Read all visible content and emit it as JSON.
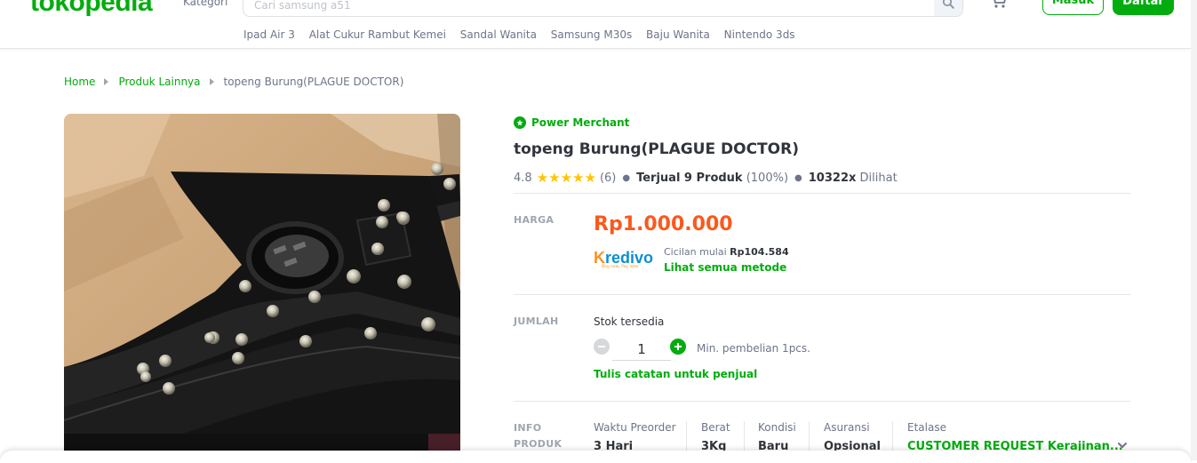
{
  "header": {
    "logo": "tokopedia",
    "kategori": "Kategori",
    "search_placeholder": "Cari samsung a51",
    "login_label": "Masuk",
    "register_label": "Daftar",
    "quick_links": [
      "Ipad Air 3",
      "Alat Cukur Rambut Kemei",
      "Sandal Wanita",
      "Samsung M30s",
      "Baju Wanita",
      "Nintendo 3ds"
    ]
  },
  "breadcrumb": {
    "items": [
      "Home",
      "Produk Lainnya"
    ],
    "current": "topeng Burung(PLAGUE DOCTOR)"
  },
  "product": {
    "badge": "Power Merchant",
    "title": "topeng Burung(PLAGUE DOCTOR)",
    "rating": "4.8",
    "stars": "★★★★★",
    "rating_count": "(6)",
    "sold_label": "Terjual 9 Produk",
    "sold_pct": "(100%)",
    "views_count": "10322x",
    "views_label": "Dilihat",
    "price_label": "HARGA",
    "price": "Rp1.000.000",
    "kredivo_brand": "kredivo",
    "kredivo_tagline": "Buy now, Pay later",
    "installment_prefix": "Cicilan mulai",
    "installment_amount": "Rp104.584",
    "see_methods": "Lihat semua metode",
    "qty_label": "JUMLAH",
    "stock_label": "Stok tersedia",
    "qty_value": "1",
    "min_purchase": "Min. pembelian 1pcs.",
    "note_link": "Tulis catatan untuk penjual",
    "info_label_1": "INFO",
    "info_label_2": "PRODUK",
    "info": [
      {
        "label": "Waktu Preorder",
        "value": "3 Hari"
      },
      {
        "label": "Berat",
        "value": "3Kg"
      },
      {
        "label": "Kondisi",
        "value": "Baru"
      },
      {
        "label": "Asuransi",
        "value": "Opsional"
      },
      {
        "label": "Etalase",
        "value": "CUSTOMER REQUEST Kerajinan..."
      }
    ]
  },
  "colors": {
    "brand_green": "#03ac0e",
    "price_orange": "#fa591d",
    "star_yellow": "#ffc400"
  }
}
